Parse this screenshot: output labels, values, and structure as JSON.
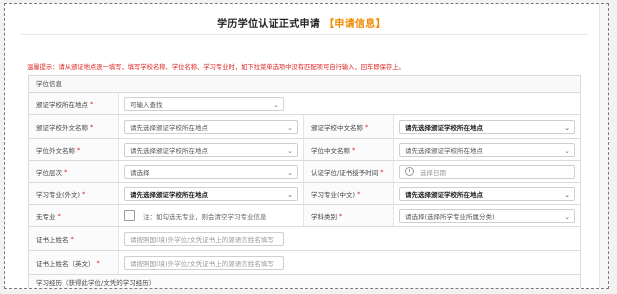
{
  "page": {
    "title": "学历学位认证正式申请",
    "title_tag": "【申请信息】",
    "tip": "温馨提示：请从颁证地点逐一填写，填写学校名称、学位名称、学习专业时，如下拉菜单选项中没有匹配项可自行输入，回车即保存上。"
  },
  "section": {
    "title": "学位信息"
  },
  "rows": {
    "country": {
      "label": "颁证学校所在地点",
      "value": "可输入查找"
    },
    "school_foreign": {
      "label": "颁证学校外文名称",
      "value": "请先选择颁证学校所在地点"
    },
    "school_cn": {
      "label": "颁证学校中文名称",
      "value": "请先选择颁证学校所在地点"
    },
    "degree_foreign": {
      "label": "学位外文名称",
      "value": "请先选择颁证学校所在地点"
    },
    "degree_cn": {
      "label": "学位中文名称",
      "value": "请先选择颁证学校所在地点"
    },
    "level": {
      "label": "学位层次",
      "value": "请选择"
    },
    "award_time": {
      "label": "认证学位/证书授予时间",
      "placeholder": "选择日期"
    },
    "major_foreign": {
      "label": "学习专业(外文)",
      "value": "请先选择颁证学校所在地点"
    },
    "major_cn": {
      "label": "学习专业(中文)",
      "value": "请先选择颁证学校所在地点"
    },
    "no_major": {
      "label": "无专业",
      "note": "注：如勾选无专业，则会清空学习专业信息"
    },
    "discipline": {
      "label": "学科类别",
      "value": "请选择(选择所学专业所属分类)"
    },
    "cert_surname": {
      "label": "证书上姓名",
      "placeholder": "请按照国(境)外学位/文凭证书上的源语言姓名填写"
    },
    "cert_fullname": {
      "label": "证书上姓名（英文）",
      "placeholder": "请按照国(境)外学位/文凭证书上的源语言姓名填写"
    }
  },
  "section2": {
    "title": "学习经历（获得此学位/文凭的学习经历）"
  },
  "colors": {
    "accent": "#f08a00",
    "required": "#e02020"
  },
  "icons": {
    "dropdown": "chevron-down-icon",
    "date": "clock-icon"
  }
}
